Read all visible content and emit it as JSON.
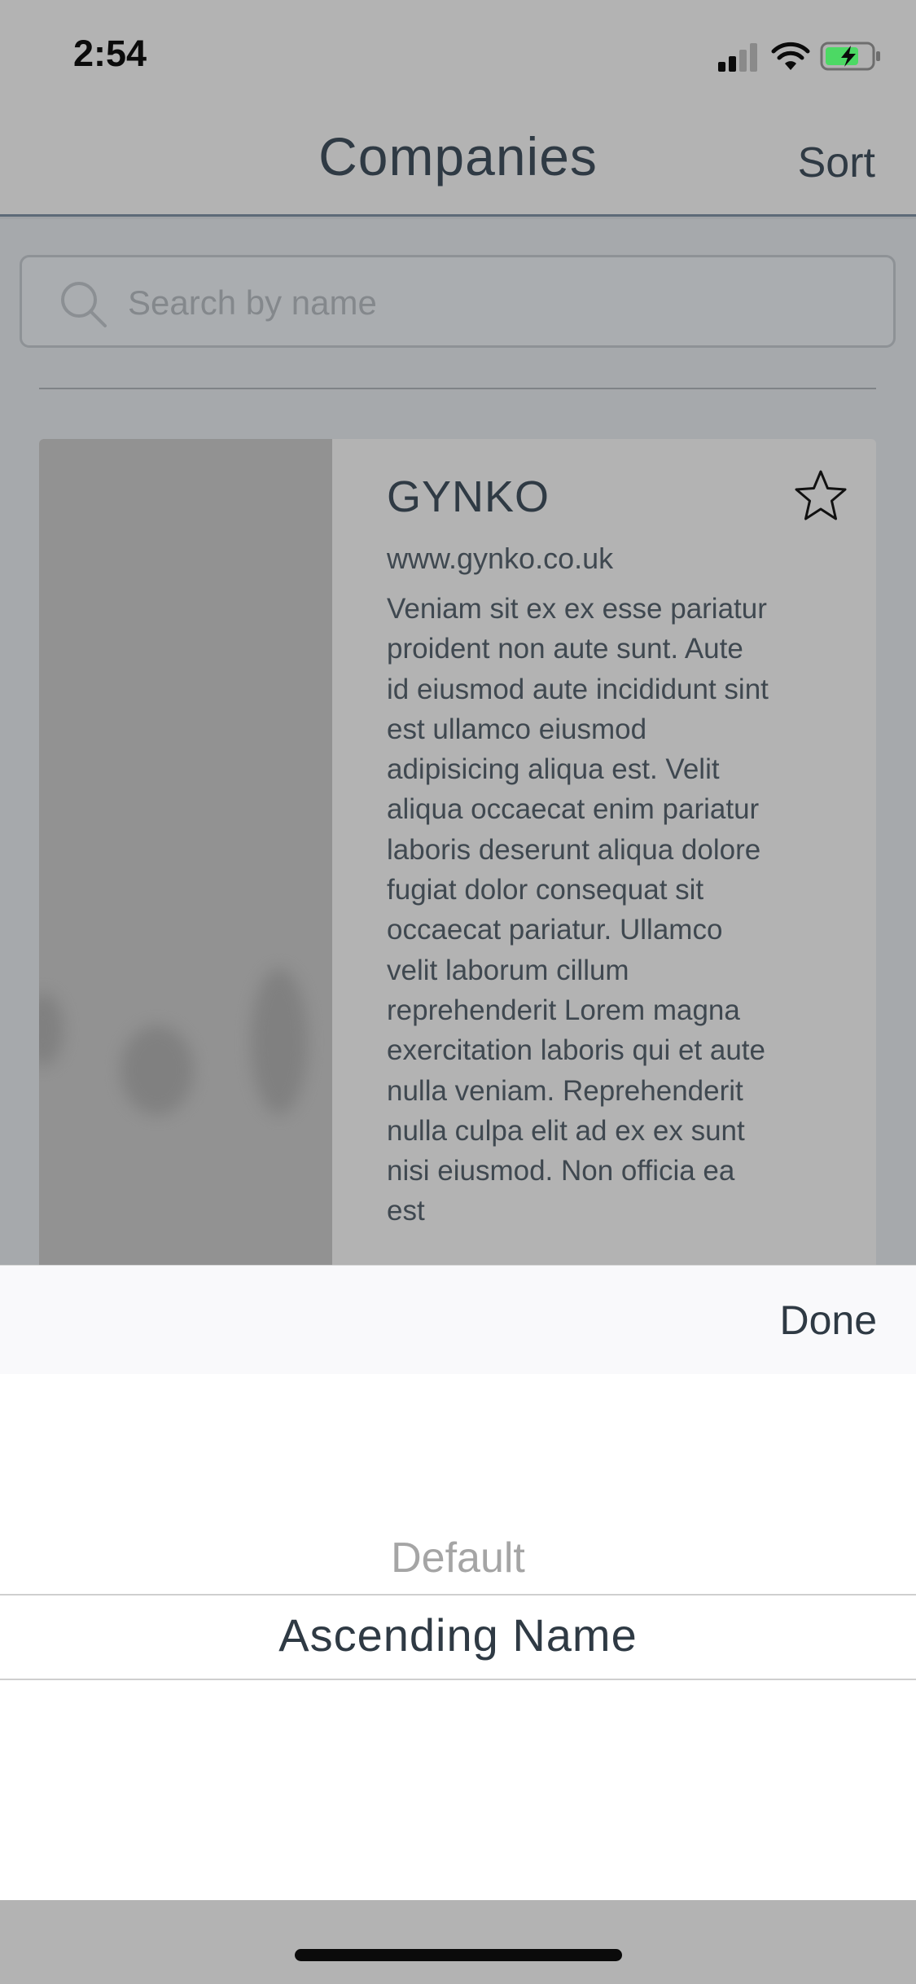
{
  "status_bar": {
    "time": "2:54"
  },
  "nav": {
    "title": "Companies",
    "sort_label": "Sort"
  },
  "search": {
    "placeholder": "Search by name"
  },
  "company": {
    "name": "GYNKO",
    "url": "www.gynko.co.uk",
    "description": "Veniam sit ex ex esse pariatur proident non aute sunt. Aute id eiusmod aute incididunt sint est ullamco eiusmod adipisicing aliqua est. Velit aliqua occaecat enim pariatur laboris deserunt aliqua dolore fugiat dolor consequat sit occaecat pariatur. Ullamco velit laborum cillum reprehenderit Lorem magna exercitation laboris qui et aute nulla veniam. Reprehenderit nulla culpa elit ad ex ex sunt nisi eiusmod. Non officia ea est",
    "favorite_icon": "star-outline-icon"
  },
  "picker": {
    "done_label": "Done",
    "options": [
      "Default",
      "Ascending Name"
    ],
    "selected": "Ascending Name"
  },
  "colors": {
    "text_primary": "#2f3a44",
    "overlay_gray": "#b3b3b3",
    "sheet_background": "#ffffff",
    "battery_green": "#4cd964"
  }
}
